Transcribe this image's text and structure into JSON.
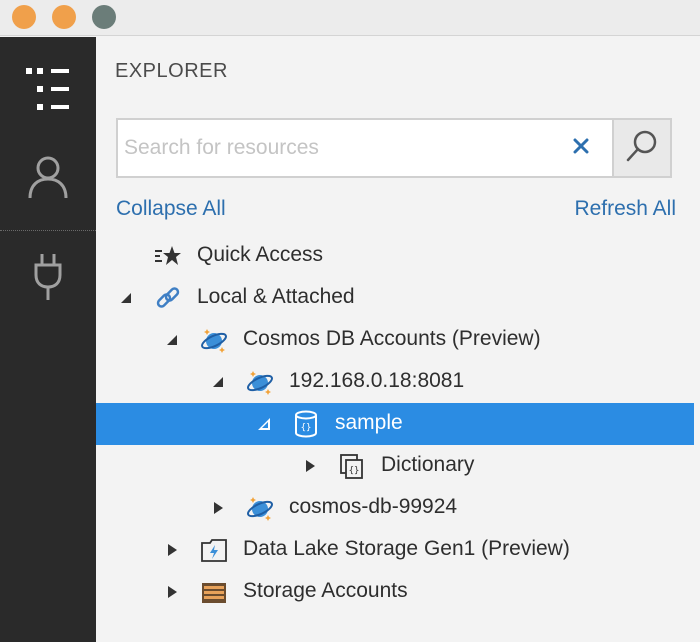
{
  "window": {
    "buttons": [
      "close",
      "minimize",
      "zoom"
    ],
    "colors": {
      "close": "#f0a04b",
      "minimize": "#f0a04b",
      "zoom": "#6b7d79"
    }
  },
  "activity_bar": {
    "items": [
      {
        "icon": "explorer-list-icon",
        "active": true
      },
      {
        "icon": "account-icon",
        "active": false
      },
      {
        "icon": "plug-icon",
        "active": false
      }
    ]
  },
  "explorer": {
    "title": "EXPLORER",
    "search": {
      "placeholder": "Search for resources",
      "value": ""
    },
    "collapse_all": "Collapse All",
    "refresh_all": "Refresh All",
    "tree": [
      {
        "label": "Quick Access",
        "icon": "quick-access-icon",
        "expander": "none"
      },
      {
        "label": "Local & Attached",
        "icon": "link-icon",
        "expander": "expanded"
      },
      {
        "label": "Cosmos DB Accounts (Preview)",
        "icon": "cosmos-db-icon",
        "expander": "expanded"
      },
      {
        "label": "192.168.0.18:8081",
        "icon": "cosmos-db-icon",
        "expander": "expanded"
      },
      {
        "label": "sample",
        "icon": "database-icon",
        "expander": "expanded",
        "selected": true
      },
      {
        "label": "Dictionary",
        "icon": "collection-icon",
        "expander": "collapsed"
      },
      {
        "label": "cosmos-db-99924",
        "icon": "cosmos-db-icon",
        "expander": "collapsed"
      },
      {
        "label": "Data Lake Storage Gen1 (Preview)",
        "icon": "data-lake-icon",
        "expander": "collapsed"
      },
      {
        "label": "Storage Accounts",
        "icon": "storage-account-icon",
        "expander": "collapsed"
      }
    ]
  },
  "colors": {
    "accent": "#2b8ce3",
    "link": "#2d6fae",
    "activity_bar": "#2a2a2a"
  }
}
